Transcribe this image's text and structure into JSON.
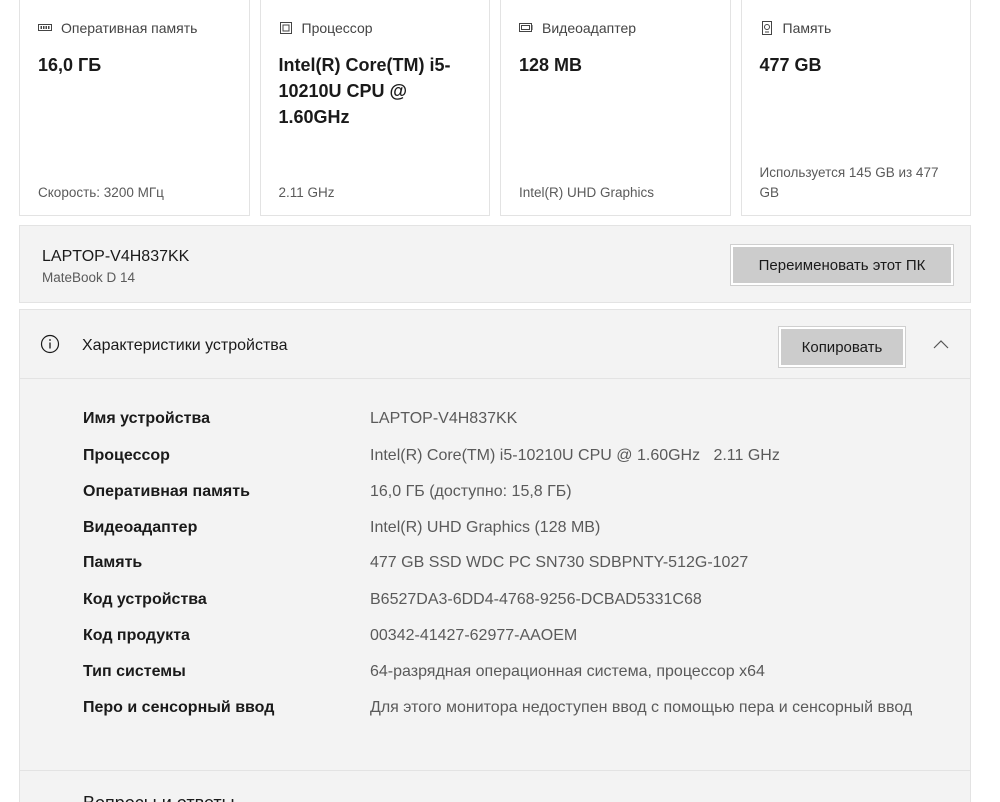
{
  "cards": [
    {
      "icon": "ram-icon",
      "label": "Оперативная память",
      "value": "16,0 ГБ",
      "footer": "Скорость: 3200 МГц"
    },
    {
      "icon": "processor-icon",
      "label": "Процессор",
      "value": "Intel(R) Core(TM) i5-10210U CPU @ 1.60GHz",
      "footer": "2.11 GHz"
    },
    {
      "icon": "video-adapter-icon",
      "label": "Видеоадаптер",
      "value": "128 MB",
      "footer": "Intel(R) UHD Graphics"
    },
    {
      "icon": "storage-icon",
      "label": "Память",
      "value": "477 GB",
      "footer": "Используется 145 GB из 477 GB"
    }
  ],
  "device": {
    "name": "LAPTOP-V4H837KK",
    "model": "MateBook D 14",
    "rename_label": "Переименовать этот ПК"
  },
  "specs": {
    "title": "Характеристики устройства",
    "copy_label": "Копировать",
    "rows": [
      {
        "name": "Имя устройства",
        "value": "LAPTOP-V4H837KK"
      },
      {
        "name": "Процессор",
        "value": "Intel(R) Core(TM) i5-10210U CPU @ 1.60GHz   2.11 GHz"
      },
      {
        "name": "Оперативная память",
        "value": "16,0 ГБ (доступно: 15,8 ГБ)"
      },
      {
        "name": "Видеоадаптер",
        "value": "Intel(R) UHD Graphics (128 MB)"
      },
      {
        "name": "Память",
        "value": "477 GB SSD WDC PC SN730 SDBPNTY-512G-1027"
      },
      {
        "name": "Код устройства",
        "value": "B6527DA3-6DD4-4768-9256-DCBAD5331C68"
      },
      {
        "name": "Код продукта",
        "value": "00342-41427-62977-AAOEM"
      },
      {
        "name": "Тип системы",
        "value": "64-разрядная операционная система, процессор x64"
      },
      {
        "name": "Перо и сенсорный ввод",
        "value": "Для этого монитора недоступен ввод с помощью пера и сенсорный ввод"
      }
    ]
  },
  "faq": {
    "title": "Вопросы и ответы"
  },
  "colors": {
    "panel_bg": "#f3f3f3",
    "button_bg": "#cccccc",
    "border": "#e3e3e3",
    "text_secondary": "#5a5a5a"
  }
}
